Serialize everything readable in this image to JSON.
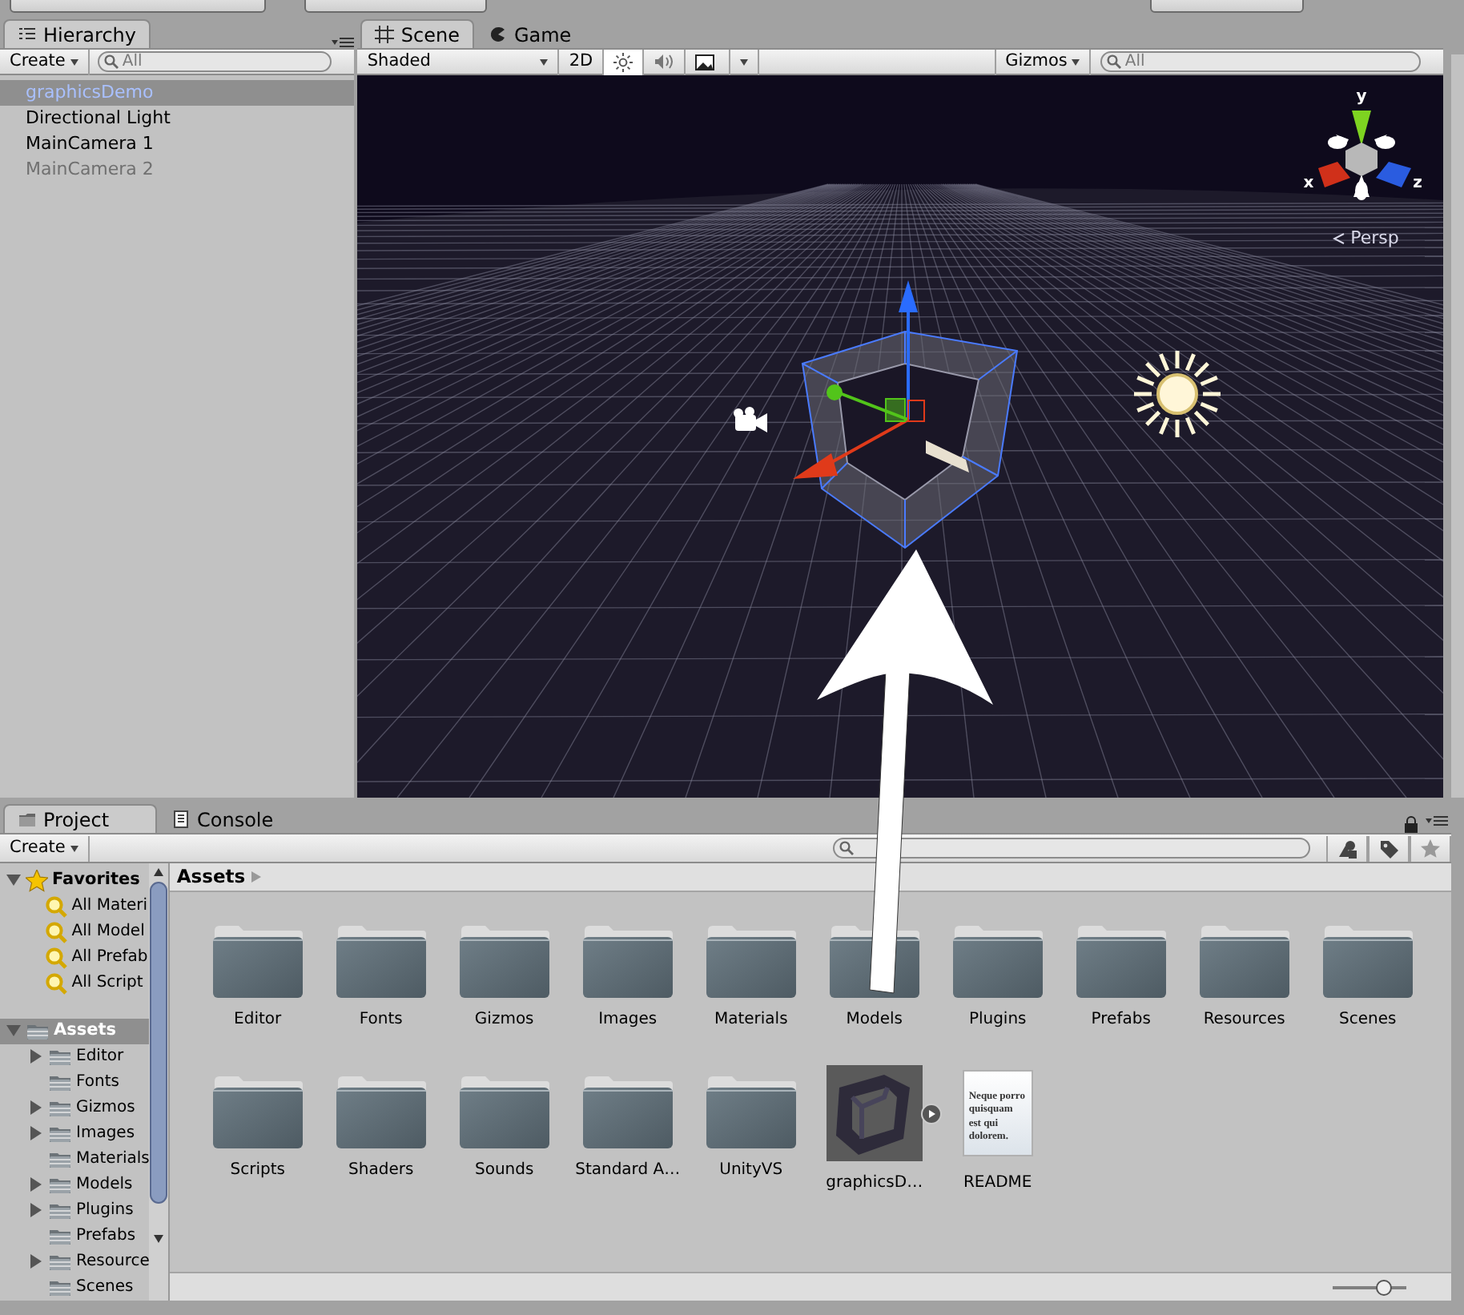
{
  "hierarchy": {
    "tab": "Hierarchy",
    "create": "Create",
    "search_placeholder": "All",
    "items": [
      {
        "label": "graphicsDemo",
        "selected": true,
        "disabled": false
      },
      {
        "label": "Directional Light",
        "selected": false,
        "disabled": false
      },
      {
        "label": "MainCamera 1",
        "selected": false,
        "disabled": false
      },
      {
        "label": "MainCamera 2",
        "selected": false,
        "disabled": true
      }
    ]
  },
  "scene": {
    "tabs": [
      {
        "label": "Scene",
        "selected": true
      },
      {
        "label": "Game",
        "selected": false
      }
    ],
    "shading": "Shaded",
    "mode_2d": "2D",
    "gizmos": "Gizmos",
    "search_placeholder": "All",
    "axes": [
      "y",
      "x",
      "z"
    ],
    "projection": "Persp"
  },
  "project": {
    "tabs": [
      {
        "label": "Project",
        "selected": true
      },
      {
        "label": "Console",
        "selected": false
      }
    ],
    "create": "Create",
    "favorites": {
      "label": "Favorites",
      "expanded": true,
      "items": [
        "All Materi",
        "All Model",
        "All Prefab",
        "All Script"
      ]
    },
    "tree": {
      "label": "Assets",
      "expanded": true,
      "selected": true,
      "children": [
        {
          "label": "Editor",
          "has_children": true
        },
        {
          "label": "Fonts",
          "has_children": false
        },
        {
          "label": "Gizmos",
          "has_children": true
        },
        {
          "label": "Images",
          "has_children": true
        },
        {
          "label": "Materials",
          "has_children": false
        },
        {
          "label": "Models",
          "has_children": true
        },
        {
          "label": "Plugins",
          "has_children": true
        },
        {
          "label": "Prefabs",
          "has_children": false
        },
        {
          "label": "Resource",
          "has_children": true
        },
        {
          "label": "Scenes",
          "has_children": false
        }
      ]
    },
    "breadcrumb": "Assets",
    "assets": [
      {
        "label": "Editor",
        "kind": "folder"
      },
      {
        "label": "Fonts",
        "kind": "folder"
      },
      {
        "label": "Gizmos",
        "kind": "folder"
      },
      {
        "label": "Images",
        "kind": "folder"
      },
      {
        "label": "Materials",
        "kind": "folder"
      },
      {
        "label": "Models",
        "kind": "folder"
      },
      {
        "label": "Plugins",
        "kind": "folder"
      },
      {
        "label": "Prefabs",
        "kind": "folder"
      },
      {
        "label": "Resources",
        "kind": "folder"
      },
      {
        "label": "Scenes",
        "kind": "folder"
      },
      {
        "label": "Scripts",
        "kind": "folder"
      },
      {
        "label": "Shaders",
        "kind": "folder"
      },
      {
        "label": "Sounds",
        "kind": "folder"
      },
      {
        "label": "Standard A…",
        "kind": "folder"
      },
      {
        "label": "UnityVS",
        "kind": "folder"
      },
      {
        "label": "graphicsD…",
        "kind": "model"
      },
      {
        "label": "README",
        "kind": "text",
        "preview": "Neque porro quisquam est qui dolorem."
      }
    ],
    "zoom_slider": {
      "level": 0.7
    }
  }
}
